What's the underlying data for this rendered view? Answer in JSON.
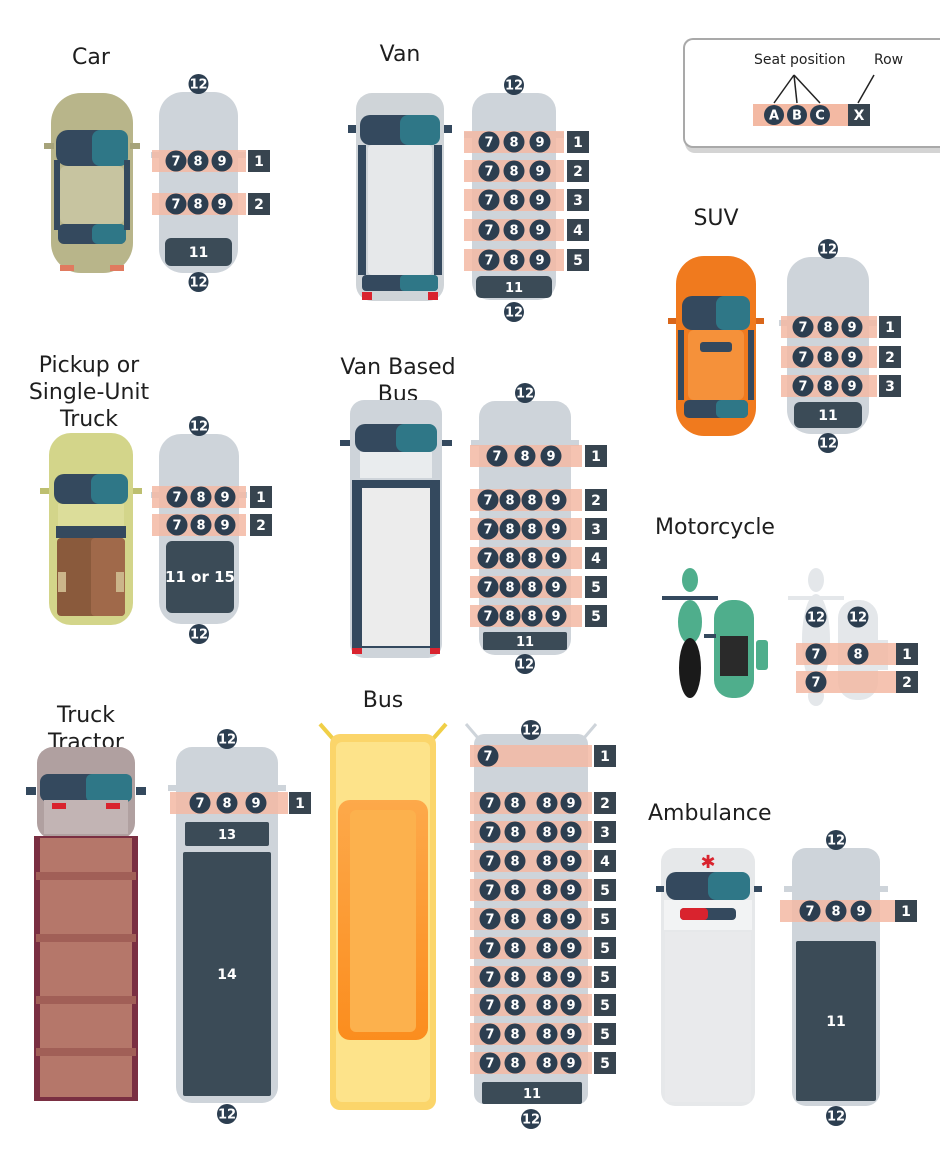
{
  "titles": {
    "car": "Car",
    "van": "Van",
    "suv": "SUV",
    "pickup": "Pickup or\nSingle-Unit Truck",
    "van_bus": "Van Based Bus",
    "motorcycle": "Motorcycle",
    "truck_tractor": "Truck Tractor",
    "bus": "Bus",
    "ambulance": "Ambulance"
  },
  "legend": {
    "seat_position_label": "Seat position",
    "row_label": "Row",
    "seat_letters": [
      "A",
      "B",
      "C"
    ],
    "row_letter": "X"
  },
  "codes": {
    "front": "12",
    "rear_cargo": "11",
    "pickup_bed": "11 or 15",
    "trailer_cab_sleeper": "13",
    "trailer_cargo": "14"
  },
  "vehicles": {
    "car": {
      "rows": [
        {
          "seats": [
            "7",
            "8",
            "9"
          ],
          "row": "1"
        },
        {
          "seats": [
            "7",
            "8",
            "9"
          ],
          "row": "2"
        }
      ]
    },
    "van": {
      "rows": [
        {
          "seats": [
            "7",
            "8",
            "9"
          ],
          "row": "1"
        },
        {
          "seats": [
            "7",
            "8",
            "9"
          ],
          "row": "2"
        },
        {
          "seats": [
            "7",
            "8",
            "9"
          ],
          "row": "3"
        },
        {
          "seats": [
            "7",
            "8",
            "9"
          ],
          "row": "4"
        },
        {
          "seats": [
            "7",
            "8",
            "9"
          ],
          "row": "5"
        }
      ]
    },
    "suv": {
      "rows": [
        {
          "seats": [
            "7",
            "8",
            "9"
          ],
          "row": "1"
        },
        {
          "seats": [
            "7",
            "8",
            "9"
          ],
          "row": "2"
        },
        {
          "seats": [
            "7",
            "8",
            "9"
          ],
          "row": "3"
        }
      ]
    },
    "pickup": {
      "rows": [
        {
          "seats": [
            "7",
            "8",
            "9"
          ],
          "row": "1"
        },
        {
          "seats": [
            "7",
            "8",
            "9"
          ],
          "row": "2"
        }
      ]
    },
    "van_bus": {
      "rows": [
        {
          "seats": [
            "7",
            "8",
            "9"
          ],
          "row": "1"
        },
        {
          "seats": [
            "7",
            "8",
            "8",
            "9"
          ],
          "row": "2"
        },
        {
          "seats": [
            "7",
            "8",
            "8",
            "9"
          ],
          "row": "3"
        },
        {
          "seats": [
            "7",
            "8",
            "8",
            "9"
          ],
          "row": "4"
        },
        {
          "seats": [
            "7",
            "8",
            "8",
            "9"
          ],
          "row": "5"
        },
        {
          "seats": [
            "7",
            "8",
            "8",
            "9"
          ],
          "row": "5"
        }
      ]
    },
    "motorcycle": {
      "rows": [
        {
          "seats": [
            "7",
            "8"
          ],
          "row": "1"
        },
        {
          "seats": [
            "7"
          ],
          "row": "2"
        }
      ]
    },
    "truck_tractor": {
      "rows": [
        {
          "seats": [
            "7",
            "8",
            "9"
          ],
          "row": "1"
        }
      ]
    },
    "bus": {
      "rows": [
        {
          "seats": [
            "7"
          ],
          "row": "1"
        },
        {
          "seats": [
            "7",
            "8",
            "8",
            "9"
          ],
          "row": "2"
        },
        {
          "seats": [
            "7",
            "8",
            "8",
            "9"
          ],
          "row": "3"
        },
        {
          "seats": [
            "7",
            "8",
            "8",
            "9"
          ],
          "row": "4"
        },
        {
          "seats": [
            "7",
            "8",
            "8",
            "9"
          ],
          "row": "5"
        },
        {
          "seats": [
            "7",
            "8",
            "8",
            "9"
          ],
          "row": "5"
        },
        {
          "seats": [
            "7",
            "8",
            "8",
            "9"
          ],
          "row": "5"
        },
        {
          "seats": [
            "7",
            "8",
            "8",
            "9"
          ],
          "row": "5"
        },
        {
          "seats": [
            "7",
            "8",
            "8",
            "9"
          ],
          "row": "5"
        },
        {
          "seats": [
            "7",
            "8",
            "8",
            "9"
          ],
          "row": "5"
        },
        {
          "seats": [
            "7",
            "8",
            "8",
            "9"
          ],
          "row": "5"
        }
      ]
    },
    "ambulance": {
      "rows": [
        {
          "seats": [
            "7",
            "8",
            "9"
          ],
          "row": "1"
        }
      ]
    }
  },
  "colors": {
    "seat_circle": "#2c3e50",
    "row_box": "#37444f",
    "seat_band": "#f3b9a3",
    "layout_body": "#ced4da",
    "dark_panel": "#3b4b57",
    "car_body": "#b8b58a",
    "suv_body": "#f07a1e",
    "pickup_body": "#d3d58a",
    "pickup_bed": "#8a5a3c",
    "truck_cab": "#b0a0a0",
    "truck_trailer": "#b5776a",
    "bus_body": "#fbd56a",
    "motorcycle_green": "#4fae8c",
    "ambulance_red": "#d9232e"
  }
}
